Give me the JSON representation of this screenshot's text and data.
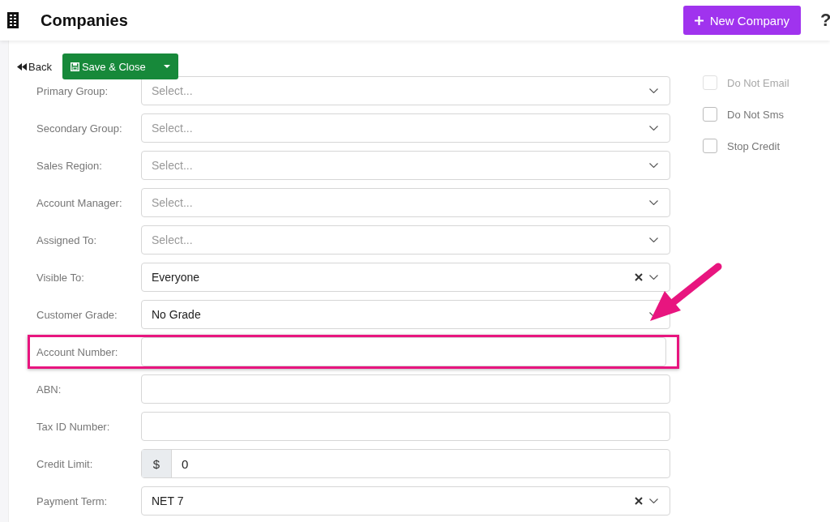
{
  "header": {
    "title": "Companies",
    "new_button": "New Company",
    "help": "?"
  },
  "toolbar": {
    "back": "Back",
    "save": "Save & Close"
  },
  "fields": [
    {
      "label": "Primary Group:",
      "kind": "select",
      "placeholder": "Select...",
      "highlighted": false
    },
    {
      "label": "Secondary Group:",
      "kind": "select",
      "placeholder": "Select...",
      "highlighted": false
    },
    {
      "label": "Sales Region:",
      "kind": "select",
      "placeholder": "Select...",
      "highlighted": false
    },
    {
      "label": "Account Manager:",
      "kind": "select",
      "placeholder": "Select...",
      "highlighted": false
    },
    {
      "label": "Assigned To:",
      "kind": "select",
      "placeholder": "Select...",
      "highlighted": false
    },
    {
      "label": "Visible To:",
      "kind": "select",
      "value": "Everyone",
      "clearable": true,
      "highlighted": false
    },
    {
      "label": "Customer Grade:",
      "kind": "select",
      "value": "No Grade",
      "highlighted": false
    },
    {
      "label": "Account Number:",
      "kind": "text",
      "highlighted": true
    },
    {
      "label": "ABN:",
      "kind": "text",
      "highlighted": false
    },
    {
      "label": "Tax ID Number:",
      "kind": "text",
      "highlighted": false
    },
    {
      "label": "Credit Limit:",
      "kind": "currency",
      "prefix": "$",
      "value": "0",
      "highlighted": false
    },
    {
      "label": "Payment Term:",
      "kind": "select",
      "value": "NET 7",
      "clearable": true,
      "highlighted": false
    }
  ],
  "checkboxes": [
    {
      "label": "Do Not Email",
      "checked": false,
      "disabled": true
    },
    {
      "label": "Do Not Sms",
      "checked": false,
      "disabled": false
    },
    {
      "label": "Stop Credit",
      "checked": false,
      "disabled": false
    }
  ]
}
